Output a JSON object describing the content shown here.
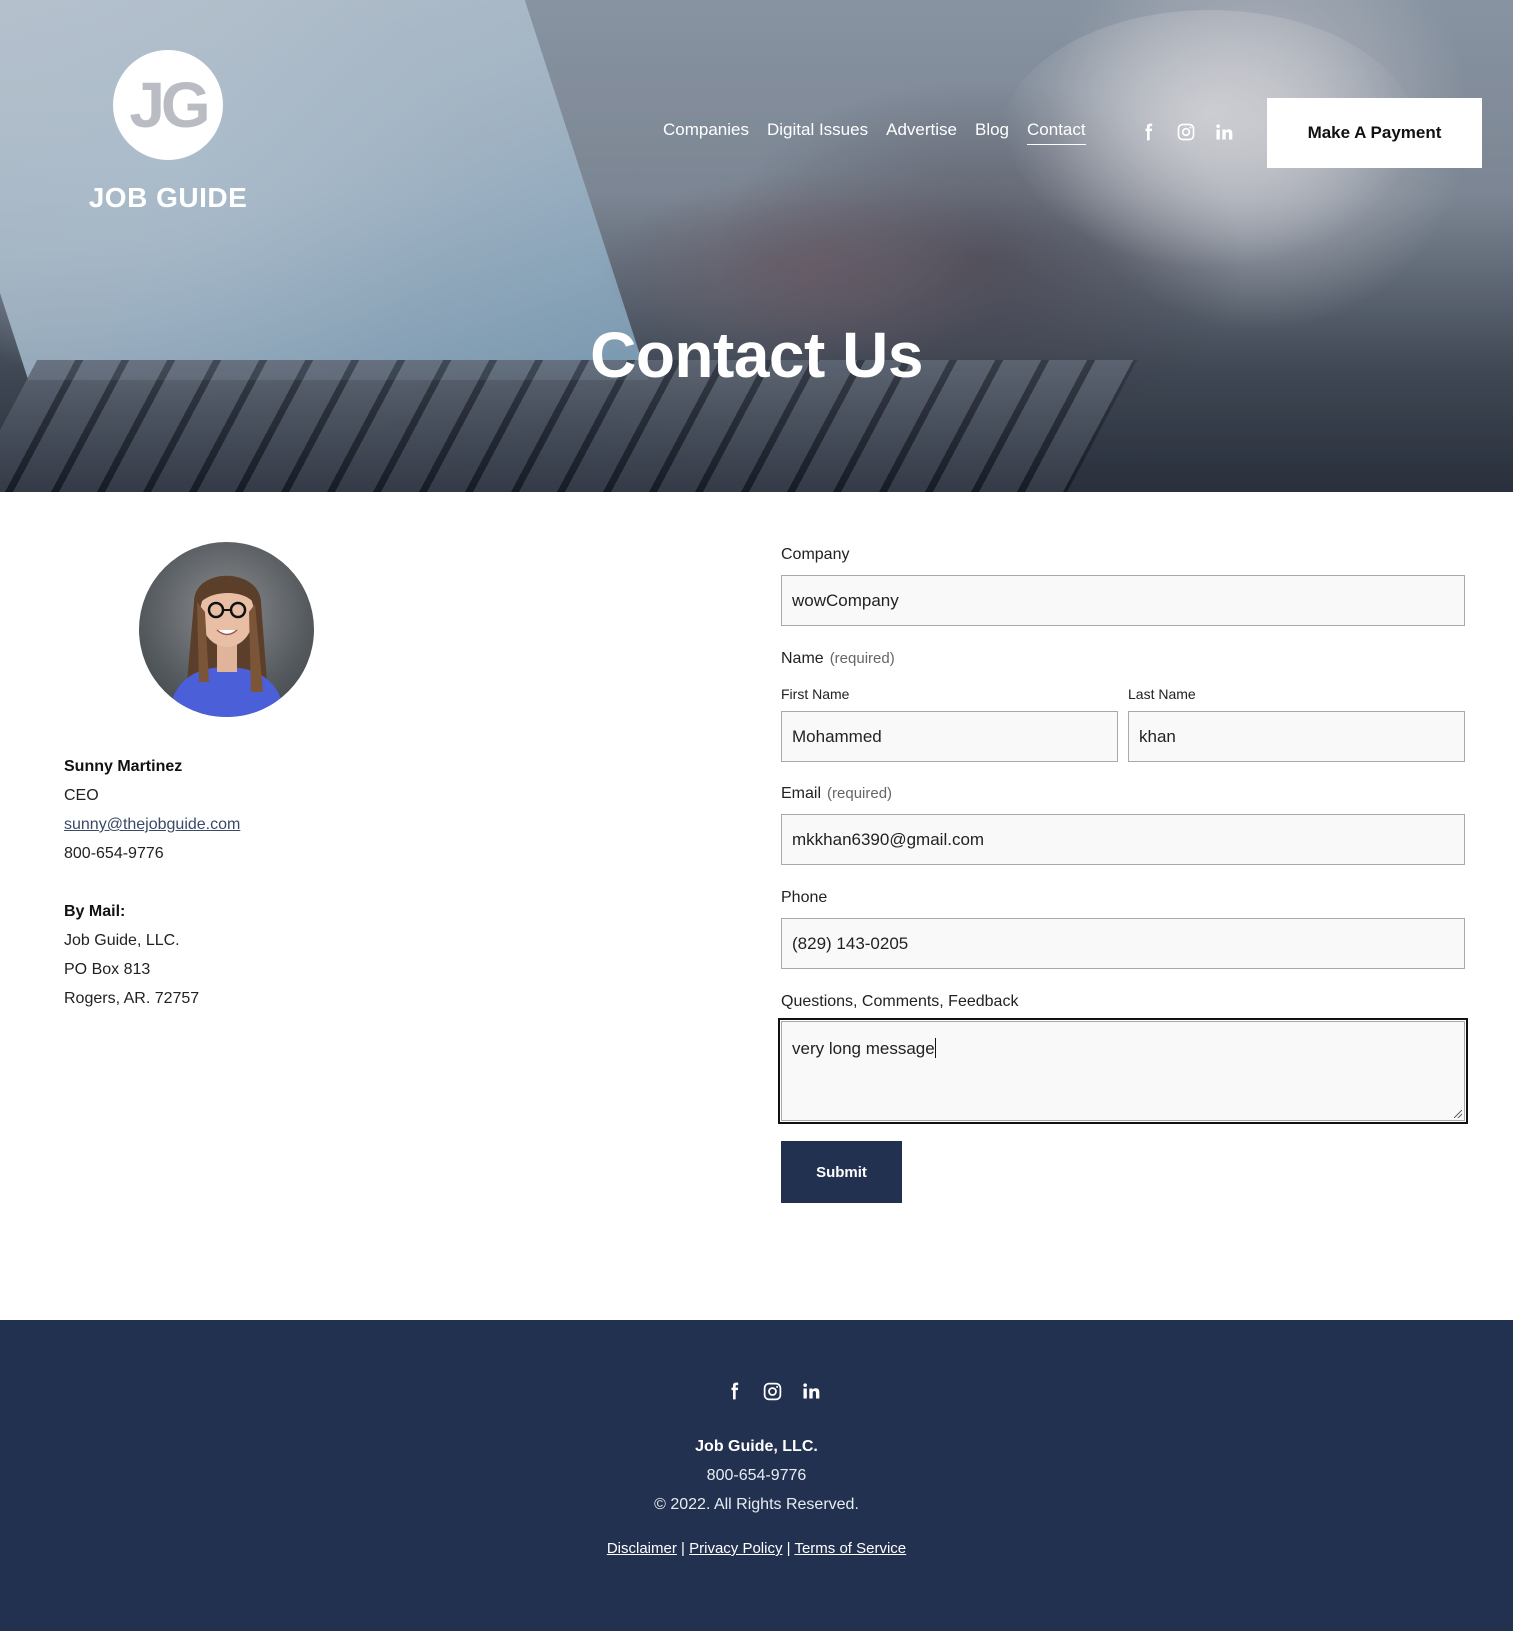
{
  "header": {
    "logo": {
      "monogram": "JG",
      "name": "JOB GUIDE"
    },
    "nav": [
      {
        "label": "Companies"
      },
      {
        "label": "Digital Issues"
      },
      {
        "label": "Advertise"
      },
      {
        "label": "Blog"
      },
      {
        "label": "Contact",
        "active": true
      }
    ],
    "social_icons": [
      "facebook-icon",
      "instagram-icon",
      "linkedin-icon"
    ],
    "payment_button": "Make A Payment"
  },
  "hero": {
    "title": "Contact Us"
  },
  "contact": {
    "name": "Sunny Martinez",
    "title": "CEO",
    "email": "sunny@thejobguide.com",
    "phone": "800-654-9776",
    "mail_heading": "By Mail:",
    "mail_lines": [
      "Job Guide, LLC.",
      "PO Box 813",
      "Rogers, AR. 72757"
    ]
  },
  "form": {
    "company": {
      "label": "Company",
      "value": "wowCompany"
    },
    "name": {
      "label": "Name",
      "required": "(required)",
      "first": {
        "label": "First Name",
        "value": "Mohammed"
      },
      "last": {
        "label": "Last Name",
        "value": "khan"
      }
    },
    "email": {
      "label": "Email",
      "required": "(required)",
      "value": "mkkhan6390@gmail.com"
    },
    "phone": {
      "label": "Phone",
      "value": "(829) 143-0205"
    },
    "comments": {
      "label": "Questions, Comments, Feedback",
      "value": "very long message"
    },
    "submit": "Submit"
  },
  "footer": {
    "social_icons": [
      "facebook-icon",
      "instagram-icon",
      "linkedin-icon"
    ],
    "company": "Job Guide, LLC",
    "phone": "800-654-9776",
    "copyright": "© 2022. All Rights Reserved.",
    "links": [
      "Disclaimer",
      "Privacy Policy",
      "Terms of Service"
    ],
    "separator": "|"
  },
  "colors": {
    "footer_bg": "#233150",
    "submit_bg": "#233150",
    "field_bg": "#f9f9f9"
  }
}
